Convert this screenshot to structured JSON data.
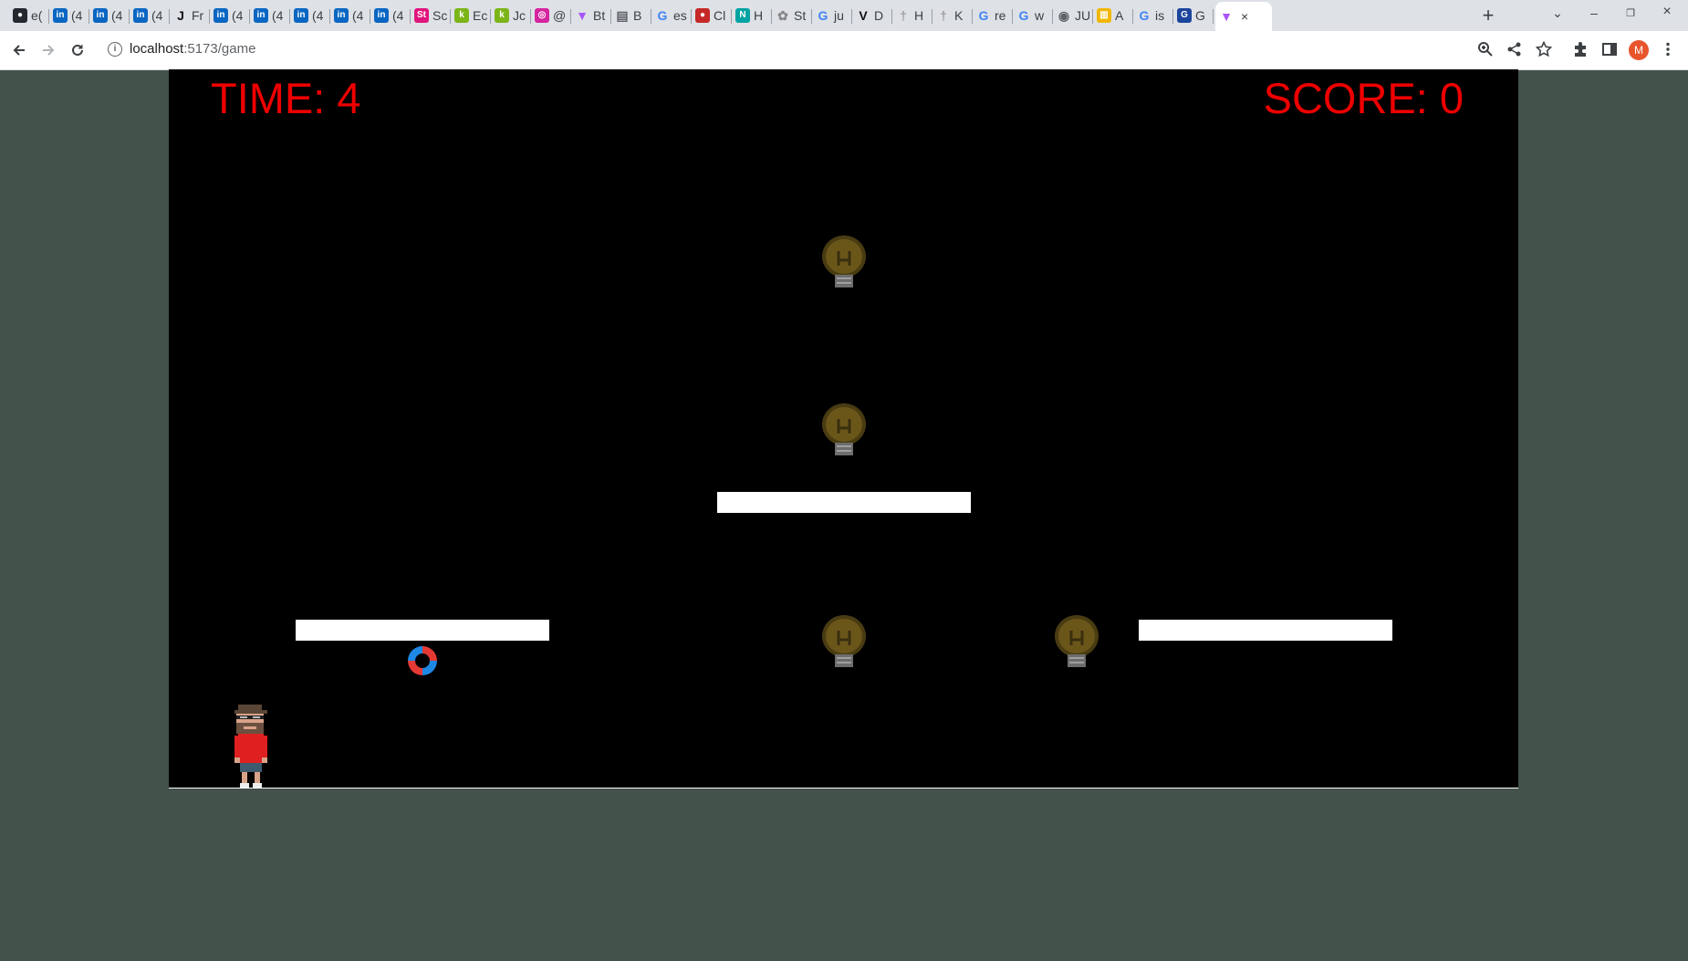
{
  "browser": {
    "tabs": [
      {
        "icon": "github-icon",
        "label": "e(",
        "color": "#24292f"
      },
      {
        "icon": "linkedin-icon",
        "label": "(4",
        "color": "#0a66c2"
      },
      {
        "icon": "linkedin-icon",
        "label": "(4",
        "color": "#0a66c2"
      },
      {
        "icon": "linkedin-icon",
        "label": "(4",
        "color": "#0a66c2"
      },
      {
        "icon": "j-icon",
        "label": "Fr",
        "color": "#111111"
      },
      {
        "icon": "linkedin-icon",
        "label": "(4",
        "color": "#0a66c2"
      },
      {
        "icon": "linkedin-icon",
        "label": "(4",
        "color": "#0a66c2"
      },
      {
        "icon": "linkedin-icon",
        "label": "(4",
        "color": "#0a66c2"
      },
      {
        "icon": "linkedin-icon",
        "label": "(4",
        "color": "#0a66c2"
      },
      {
        "icon": "linkedin-icon",
        "label": "(4",
        "color": "#0a66c2"
      },
      {
        "icon": "st-icon",
        "label": "Sc",
        "color": "#e0157c"
      },
      {
        "icon": "k-icon",
        "label": "Ec",
        "color": "#7cb518"
      },
      {
        "icon": "k-icon",
        "label": "Jc",
        "color": "#7cb518"
      },
      {
        "icon": "instagram-icon",
        "label": "@",
        "color": "#d6249f"
      },
      {
        "icon": "vite-icon",
        "label": "Bt",
        "color": "#a855f7"
      },
      {
        "icon": "doc-icon",
        "label": "B",
        "color": "#5f6368"
      },
      {
        "icon": "google-icon",
        "label": "es",
        "color": "#4285f4"
      },
      {
        "icon": "mouth-icon",
        "label": "Cl",
        "color": "#c62828"
      },
      {
        "icon": "n-icon",
        "label": "H",
        "color": "#00a3a3"
      },
      {
        "icon": "flower-icon",
        "label": "St",
        "color": "#888888"
      },
      {
        "icon": "google-icon",
        "label": "ju",
        "color": "#4285f4"
      },
      {
        "icon": "v-icon",
        "label": "D",
        "color": "#111111"
      },
      {
        "icon": "figure-icon",
        "label": "H",
        "color": "#9e9e9e"
      },
      {
        "icon": "figure-icon",
        "label": "K",
        "color": "#9e9e9e"
      },
      {
        "icon": "google-icon",
        "label": "re",
        "color": "#4285f4"
      },
      {
        "icon": "google-icon",
        "label": "w",
        "color": "#4285f4"
      },
      {
        "icon": "circle-icon",
        "label": "JU",
        "color": "#5f6368"
      },
      {
        "icon": "stripes-icon",
        "label": "A",
        "color": "#f2b705"
      },
      {
        "icon": "google-icon",
        "label": "is",
        "color": "#4285f4"
      },
      {
        "icon": "gmx-icon",
        "label": "G",
        "color": "#1c449b"
      }
    ],
    "active_tab": {
      "icon": "vite-icon",
      "label": "",
      "color": "#a855f7",
      "close": "×"
    },
    "new_tab": "+",
    "window_controls": {
      "list": "⌄",
      "minimize": "–",
      "restore": "❐",
      "close": "×"
    },
    "url_host": "localhost",
    "url_path": ":5173/game",
    "avatar_letter": "M"
  },
  "game": {
    "time_label": "TIME: 4",
    "score_label": "SCORE: 0",
    "colors": {
      "hud": "#ee0000",
      "background": "#000000",
      "platform": "#ffffff",
      "page": "#43524a"
    }
  }
}
